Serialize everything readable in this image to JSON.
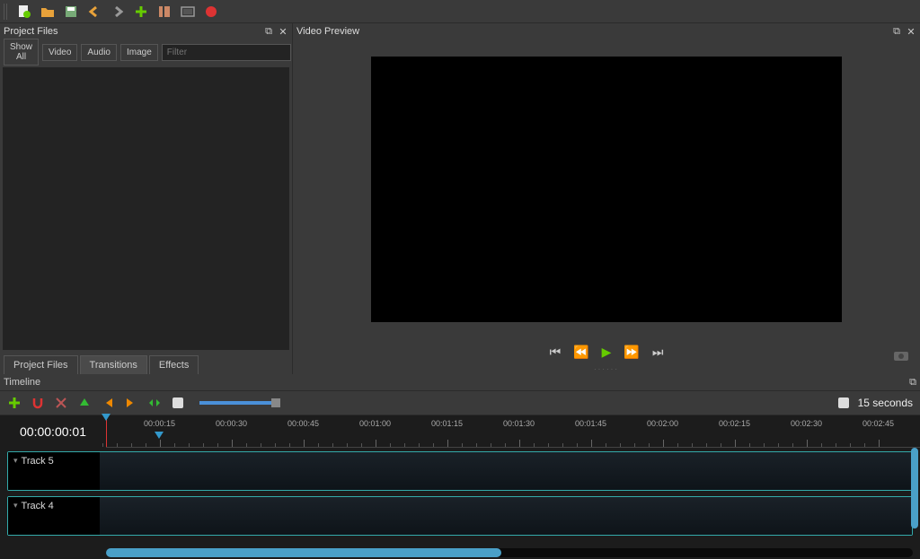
{
  "panels": {
    "project_files": "Project Files",
    "video_preview": "Video Preview",
    "timeline": "Timeline"
  },
  "pf_filters": {
    "show_all": "Show All",
    "video": "Video",
    "audio": "Audio",
    "image": "Image",
    "filter_placeholder": "Filter"
  },
  "pf_tabs": {
    "project_files": "Project Files",
    "transitions": "Transitions",
    "effects": "Effects"
  },
  "timeline": {
    "timecode": "00:00:00:01",
    "zoom_label": "15 seconds",
    "ticks": [
      "00:00:15",
      "00:00:30",
      "00:00:45",
      "00:01:00",
      "00:01:15",
      "00:01:30",
      "00:01:45",
      "00:02:00",
      "00:02:15",
      "00:02:30",
      "00:02:45"
    ],
    "tracks": [
      {
        "name": "Track 5"
      },
      {
        "name": "Track 4"
      }
    ]
  }
}
